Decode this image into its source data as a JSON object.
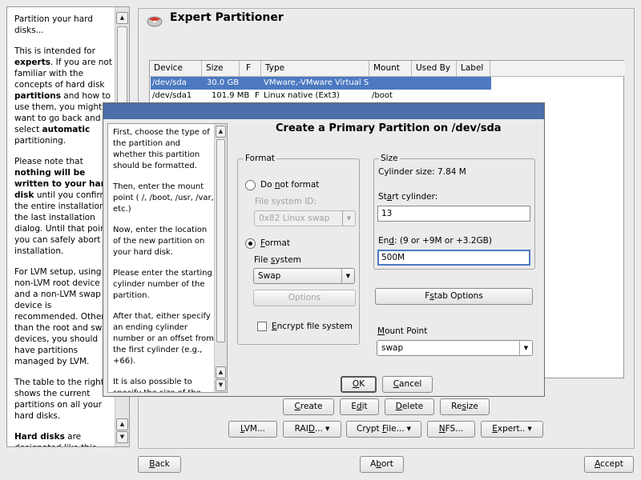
{
  "help": {
    "paragraphs": [
      [
        "Partition your hard disks..."
      ],
      [
        "This is intended for ",
        "@experts",
        ". If you are not familiar with the concepts of hard disk ",
        "@partitions",
        " and how to use them, you might want to go back and select ",
        "@automatic",
        " partitioning."
      ],
      [
        "Please note that ",
        "@nothing will be written to your hard disk",
        " until you confirm the entire installation in the last installation dialog. Until that point, you can safely abort the installation."
      ],
      [
        "For LVM setup, using a non-LVM root device and a non-LVM swap device is recommended. Other than the root and swap devices, you should have partitions managed by LVM."
      ],
      [
        "The table to the right shows the current partitions on all your hard disks."
      ],
      [
        "@Hard disks",
        " are designated like this"
      ]
    ]
  },
  "main": {
    "title": "Expert Partitioner",
    "table": {
      "headers": [
        "Device",
        "Size",
        "F",
        "Type",
        "Mount",
        "Used By",
        "Label"
      ],
      "rows": [
        {
          "device": "/dev/sda",
          "size": "30.0 GB",
          "f": "",
          "type": "VMware,-VMware Virtual S",
          "mount": "",
          "used_by": "",
          "label": ""
        },
        {
          "device": "/dev/sda1",
          "size": "101.9 MB",
          "f": "F",
          "type": "Linux native (Ext3)",
          "mount": "/boot",
          "used_by": "",
          "label": ""
        }
      ]
    },
    "buttons_row1": {
      "create": "Create",
      "edit": "Edit",
      "delete": "Delete",
      "resize": "Resize"
    },
    "buttons_row2": {
      "lvm": "LVM...",
      "raid": "RAID...",
      "crypt": "Crypt File...",
      "nfs": "NFS...",
      "expert": "Expert.."
    }
  },
  "footer": {
    "back": "Back",
    "abort": "Abort",
    "accept": "Accept"
  },
  "dialog": {
    "title": "Create a Primary Partition on /dev/sda",
    "help": [
      "First, choose the type of the partition and whether this partition should be formatted.",
      "Then, enter the mount point ( /, /boot, /usr, /var, etc.)",
      "Now, enter the location of the new partition on your hard disk.",
      "Please enter the starting cylinder number of the partition.",
      "After that, either specify an ending cylinder number or an offset from the first cylinder (e.g., +66).",
      "It is also possible to specify the size of the"
    ],
    "format": {
      "group_label": "Format",
      "do_not_format": "Do not format",
      "file_system_id_label": "File system ID:",
      "file_system_id_value": "0x82 Linux swap",
      "format_label": "Format",
      "file_system_label": "File system",
      "file_system_value": "Swap",
      "options_button": "Options",
      "encrypt_label": "Encrypt file system",
      "selected": "format",
      "encrypt_checked": false
    },
    "size": {
      "group_label": "Size",
      "cylinder_size": "Cylinder size: 7.84 M",
      "start_label": "Start cylinder:",
      "start_value": "13",
      "end_label": "End:  (9 or +9M or +3.2GB)",
      "end_value": "500M"
    },
    "fstab_button": "Fstab Options",
    "mount_point_label": "Mount Point",
    "mount_point_value": "swap",
    "ok": "OK",
    "cancel": "Cancel"
  },
  "colors": {
    "selection": "#4d79c1",
    "dialog_titlebar": "#4b6fa9",
    "focus_border": "#4d79c1"
  }
}
